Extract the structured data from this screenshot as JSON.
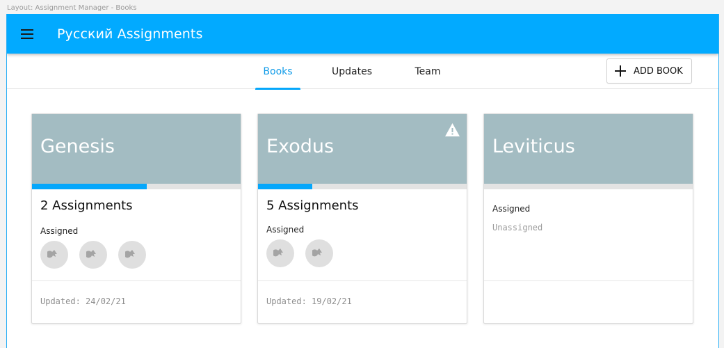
{
  "caption": "Layout: Assignment Manager - Books",
  "appbar": {
    "title": "Русский Assignments",
    "menu_icon": "hamburger-menu-icon",
    "color": "#02aaff"
  },
  "tabs": [
    {
      "label": "Books",
      "active": true
    },
    {
      "label": "Updates",
      "active": false
    },
    {
      "label": "Team",
      "active": false
    }
  ],
  "add_button": {
    "label": "ADD BOOK",
    "icon": "plus-icon"
  },
  "books": [
    {
      "title": "Genesis",
      "progress": 0.55,
      "assignments_label": "2 Assignments",
      "assigned_label": "Assigned",
      "avatar_count": 3,
      "updated": "Updated: 24/02/21",
      "warning": false
    },
    {
      "title": "Exodus",
      "progress": 0.26,
      "assignments_label": "5 Assignments",
      "assigned_label": "Assigned",
      "avatar_count": 2,
      "updated": "Updated: 19/02/21",
      "warning": true
    },
    {
      "title": "Leviticus",
      "progress": 0,
      "assigned_label": "Assigned",
      "unassigned_label": "Unassigned",
      "warning": false
    }
  ],
  "colors": {
    "accent": "#05a7fb",
    "card_header": "#a3bcc2",
    "progress_track": "#e3e3e3"
  }
}
